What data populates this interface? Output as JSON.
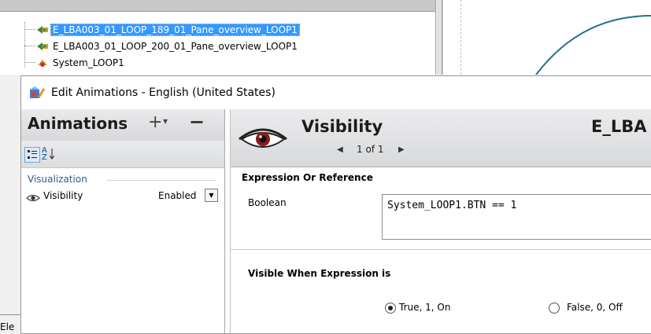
{
  "tree": {
    "items": [
      {
        "label": "E_LBA003_01_LOOP_189_01_Pane_overview_LOOP1",
        "selected": true
      },
      {
        "label": "E_LBA003_01_LOOP_200_01_Pane_overview_LOOP1",
        "selected": false
      },
      {
        "label": "System_LOOP1",
        "selected": false
      }
    ]
  },
  "dialog": {
    "title": "Edit Animations - English (United States)"
  },
  "animations": {
    "title": "Animations",
    "add_symbol": "+",
    "add_dropdown_symbol": "▾",
    "remove_symbol": "−",
    "sort_az_symbol": "A Z",
    "group_label": "Visualization",
    "rows": [
      {
        "name": "Visibility",
        "state": "Enabled"
      }
    ]
  },
  "detail": {
    "title": "Visibility",
    "object_name": "E_LBA",
    "pager": {
      "prev": "◀",
      "text": "1 of 1",
      "next": "▶"
    },
    "expression_section": "Expression Or Reference",
    "boolean_label": "Boolean",
    "expression_value": "System_LOOP1.BTN == 1",
    "visible_when_label": "Visible When Expression is",
    "options": [
      {
        "label": "True, 1, On",
        "selected": true
      },
      {
        "label": "False, 0, Off",
        "selected": false
      }
    ]
  },
  "fragment": {
    "text": "Ele"
  },
  "colors": {
    "selection": "#3399ff",
    "group_text": "#2f5c8c",
    "curve": "#1f6f8b"
  }
}
